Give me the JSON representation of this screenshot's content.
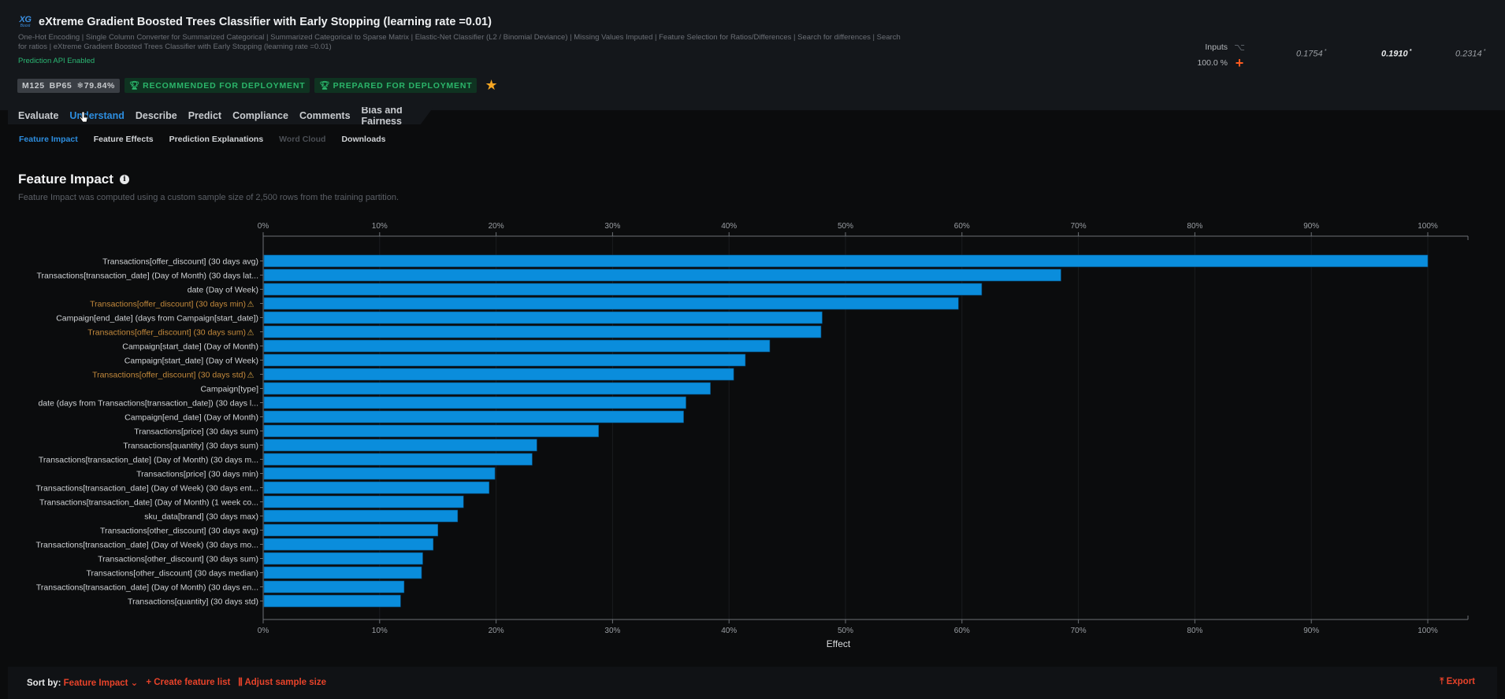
{
  "header": {
    "logo": {
      "line1": "XG",
      "line2": "Boost"
    },
    "title": "eXtreme Gradient Boosted Trees Classifier with Early Stopping (learning rate =0.01)",
    "blueprint_line1": "One-Hot Encoding | Single Column Converter for Summarized Categorical | Summarized Categorical to Sparse Matrix | Elastic-Net Classifier (L2 / Binomial Deviance) | Missing Values Imputed | Feature Selection for Ratios/Differences | Search for differences | Search",
    "blueprint_line2": "for ratios | eXtreme Gradient Boosted Trees Classifier with Early Stopping (learning rate =0.01)",
    "api_status": "Prediction API Enabled",
    "badges": {
      "model_id": "M125",
      "blueprint_id": "BP65",
      "sample_pct": "79.84%",
      "recommended": "RECOMMENDED FOR DEPLOYMENT",
      "prepared": "PREPARED FOR DEPLOYMENT"
    },
    "starred": true,
    "inputs_label": "Inputs",
    "inputs_pct": "100.0 %",
    "metrics": [
      {
        "value": "0.1754",
        "mark": "*",
        "active": false
      },
      {
        "value": "0.1910",
        "mark": "*",
        "active": true
      },
      {
        "value": "0.2314",
        "mark": "*",
        "active": false
      }
    ]
  },
  "tabs": [
    {
      "label": "Evaluate",
      "active": false
    },
    {
      "label": "Understand",
      "active": true
    },
    {
      "label": "Describe",
      "active": false
    },
    {
      "label": "Predict",
      "active": false
    },
    {
      "label": "Compliance",
      "active": false
    },
    {
      "label": "Comments",
      "active": false
    },
    {
      "label": "Bias and Fairness",
      "active": false
    }
  ],
  "subtabs": [
    {
      "label": "Feature Impact",
      "state": "active"
    },
    {
      "label": "Feature Effects",
      "state": "normal"
    },
    {
      "label": "Prediction Explanations",
      "state": "normal"
    },
    {
      "label": "Word Cloud",
      "state": "disabled"
    },
    {
      "label": "Downloads",
      "state": "normal"
    }
  ],
  "section": {
    "title": "Feature Impact",
    "description": "Feature Impact was computed using a custom sample size of 2,500 rows from the training partition."
  },
  "colors": {
    "bar": "#0a8ddc",
    "warning_label": "#c48a3c",
    "accent": "#2d8ee0",
    "action": "#e8432a"
  },
  "chart_data": {
    "type": "bar",
    "orientation": "horizontal",
    "title": "Feature Impact",
    "xlabel": "Effect",
    "ylabel": "",
    "xlim": [
      0,
      100
    ],
    "x_ticks": [
      "0%",
      "10%",
      "20%",
      "30%",
      "40%",
      "50%",
      "60%",
      "70%",
      "80%",
      "90%",
      "100%"
    ],
    "grid": true,
    "axis_top_and_bottom": true,
    "categories": [
      "Transactions[offer_discount] (30 days avg)",
      "Transactions[transaction_date] (Day of Month) (30 days lat...",
      "date (Day of Week)",
      "Transactions[offer_discount] (30 days min)",
      "Campaign[end_date] (days from Campaign[start_date])",
      "Transactions[offer_discount] (30 days sum)",
      "Campaign[start_date] (Day of Month)",
      "Campaign[start_date] (Day of Week)",
      "Transactions[offer_discount] (30 days std)",
      "Campaign[type]",
      "date (days from Transactions[transaction_date]) (30 days l...",
      "Campaign[end_date] (Day of Month)",
      "Transactions[price] (30 days sum)",
      "Transactions[quantity] (30 days sum)",
      "Transactions[transaction_date] (Day of Month) (30 days m...",
      "Transactions[price] (30 days min)",
      "Transactions[transaction_date] (Day of Week) (30 days ent...",
      "Transactions[transaction_date] (Day of Month) (1 week co...",
      "sku_data[brand] (30 days max)",
      "Transactions[other_discount] (30 days avg)",
      "Transactions[transaction_date] (Day of Week) (30 days mo...",
      "Transactions[other_discount] (30 days sum)",
      "Transactions[other_discount] (30 days median)",
      "Transactions[transaction_date] (Day of Month) (30 days en...",
      "Transactions[quantity] (30 days std)"
    ],
    "values": [
      100,
      68.5,
      61.7,
      59.7,
      48.0,
      47.9,
      43.5,
      41.4,
      40.4,
      38.4,
      36.3,
      36.1,
      28.8,
      23.5,
      23.1,
      19.9,
      19.4,
      17.2,
      16.7,
      15.0,
      14.6,
      13.7,
      13.6,
      12.1,
      11.8
    ],
    "warnings": [
      false,
      false,
      false,
      true,
      false,
      true,
      false,
      false,
      true,
      false,
      false,
      false,
      false,
      false,
      false,
      false,
      false,
      false,
      false,
      false,
      false,
      false,
      false,
      false,
      false
    ],
    "warning_icon": "⚠"
  },
  "footer": {
    "sort_label": "Sort by:",
    "sort_value": "Feature Impact",
    "create_feature_list": "Create feature list",
    "adjust_sample_size": "Adjust sample size",
    "export": "Export"
  }
}
